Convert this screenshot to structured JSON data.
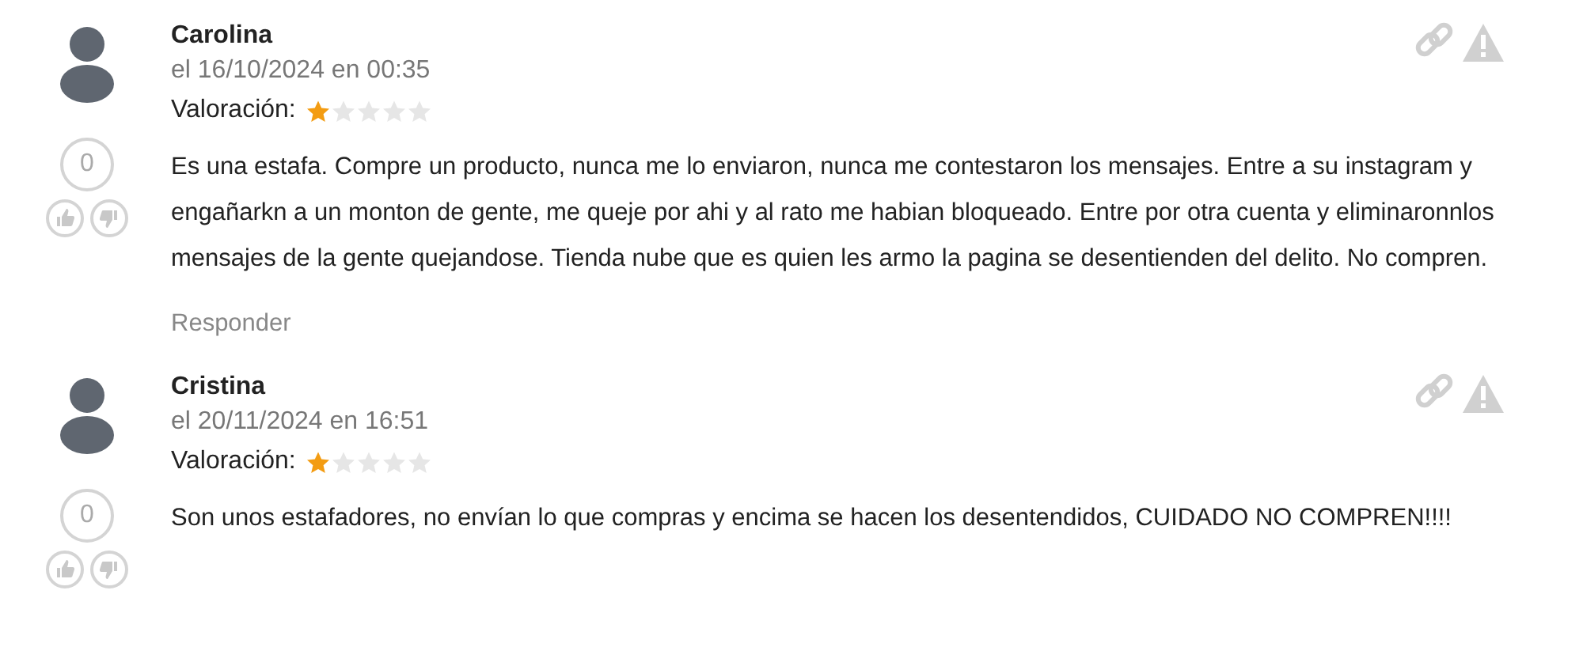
{
  "reviews": [
    {
      "author": "Carolina",
      "date": "el 16/10/2024 en 00:35",
      "rating_label": "Valoración:",
      "stars": 1,
      "score": "0",
      "text": "Es una estafa. Compre un producto, nunca me lo enviaron, nunca me contestaron los mensajes. Entre a su instagram y engañarkn a un monton de gente, me queje por ahi y al rato me habian bloqueado. Entre por otra cuenta y eliminaronnlos mensajes de la gente quejandose. Tienda nube que es quien les armo la pagina se desentienden del delito. No compren.",
      "reply": "Responder"
    },
    {
      "author": "Cristina",
      "date": "el 20/11/2024 en 16:51",
      "rating_label": "Valoración:",
      "stars": 1,
      "score": "0",
      "text": "Son unos estafadores, no envían lo que compras y encima se hacen los desentendidos, CUIDADO NO COMPREN!!!!"
    }
  ]
}
